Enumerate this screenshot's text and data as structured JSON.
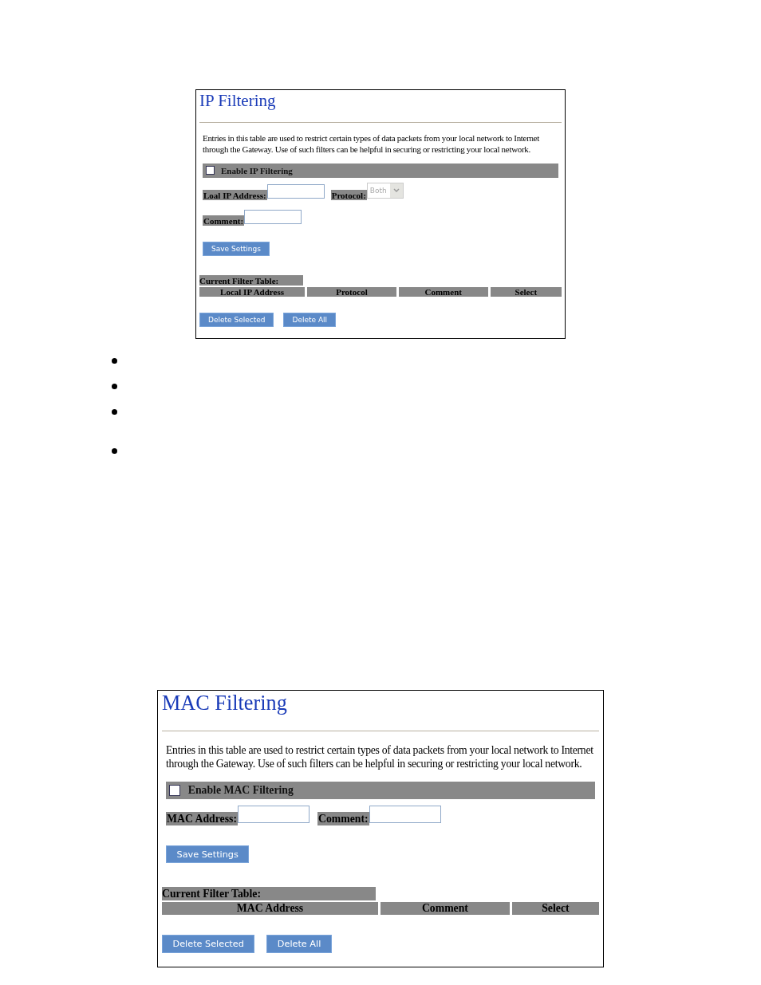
{
  "panels": [
    {
      "title": "IP Filtering",
      "description": "Entries in this table are used to restrict certain types of data packets from your local network to Internet through the Gateway. Use of such filters can be helpful in securing or restricting your local network.",
      "enable": {
        "label": "Enable IP Filtering",
        "checked": false
      },
      "field_rows": [
        [
          {
            "kind": "input",
            "label": "Loal IP Address:"
          },
          {
            "kind": "select",
            "label": "Protocol:",
            "value": "Both",
            "disabled": true
          }
        ],
        [
          {
            "kind": "input",
            "label": "Comment:"
          }
        ]
      ],
      "save_button": "Save Settings",
      "table": {
        "title": "Current Filter Table:",
        "columns": [
          "Local IP Address",
          "Protocol",
          "Comment",
          "Select"
        ]
      },
      "buttons": [
        "Delete Selected",
        "Delete All"
      ]
    },
    {
      "title": "MAC Filtering",
      "description": "Entries in this table are used to restrict certain types of data packets from your local network to Internet through the Gateway. Use of such filters can be helpful in securing or restricting your local network.",
      "enable": {
        "label": "Enable MAC Filtering",
        "checked": false
      },
      "field_rows": [
        [
          {
            "kind": "input",
            "label": "MAC Address:"
          },
          {
            "kind": "input",
            "label": "Comment:"
          }
        ]
      ],
      "save_button": "Save Settings",
      "table": {
        "title": "Current Filter Table:",
        "columns": [
          "MAC Address",
          "Comment",
          "Select"
        ]
      },
      "buttons": [
        "Delete Selected",
        "Delete All"
      ]
    }
  ]
}
